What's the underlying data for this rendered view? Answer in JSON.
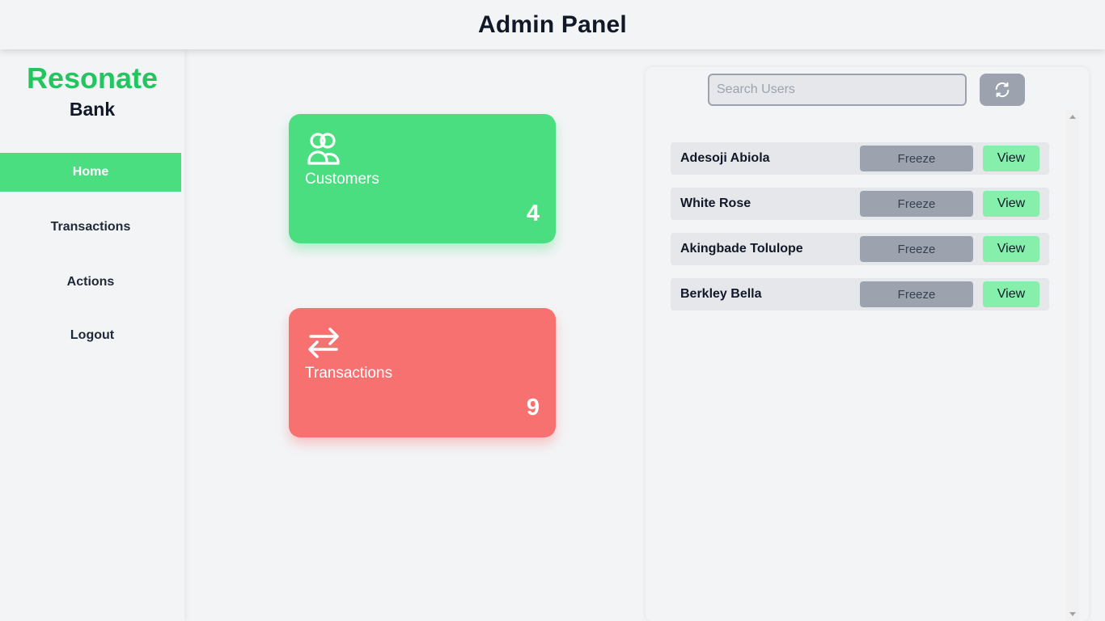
{
  "header": {
    "title": "Admin Panel"
  },
  "brand": {
    "name": "Resonate",
    "sub": "Bank"
  },
  "sidebar": {
    "items": [
      {
        "label": "Home",
        "active": true
      },
      {
        "label": "Transactions",
        "active": false
      },
      {
        "label": "Actions",
        "active": false
      },
      {
        "label": "Logout",
        "active": false
      }
    ]
  },
  "cards": [
    {
      "label": "Customers",
      "count": "4",
      "icon": "users-icon",
      "color": "#4ade80"
    },
    {
      "label": "Transactions",
      "count": "9",
      "icon": "arrows-exchange-icon",
      "color": "#f87171"
    }
  ],
  "search": {
    "placeholder": "Search Users",
    "value": ""
  },
  "refresh": {
    "icon": "refresh-icon"
  },
  "users": [
    {
      "name": "Adesoji Abiola",
      "freeze_label": "Freeze",
      "view_label": "View"
    },
    {
      "name": "White Rose",
      "freeze_label": "Freeze",
      "view_label": "View"
    },
    {
      "name": "Akingbade Tolulope",
      "freeze_label": "Freeze",
      "view_label": "View"
    },
    {
      "name": "Berkley Bella",
      "freeze_label": "Freeze",
      "view_label": "View"
    }
  ],
  "colors": {
    "accent": "#22c55e",
    "green_card": "#4ade80",
    "red_card": "#f87171",
    "view_button": "#86efac",
    "freeze_button": "#9ca3af"
  }
}
